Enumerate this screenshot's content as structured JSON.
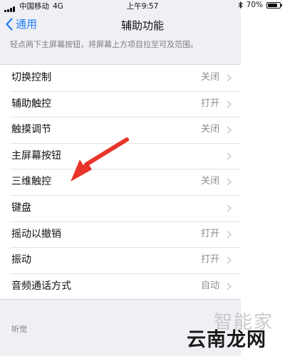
{
  "status_bar": {
    "carrier": "中国移动",
    "network": "4G",
    "time": "上午9:57",
    "battery": "70%"
  },
  "navbar": {
    "back_label": "通用",
    "title": "辅助功能"
  },
  "description": "轻点两下主屏幕按钮，将屏幕上方项目拉至可及范围。",
  "rows": [
    {
      "label": "切换控制",
      "value": "关闭"
    },
    {
      "label": "辅助触控",
      "value": "打开"
    },
    {
      "label": "触摸调节",
      "value": "关闭"
    },
    {
      "label": "主屏幕按钮",
      "value": ""
    },
    {
      "label": "三维触控",
      "value": "关闭"
    },
    {
      "label": "键盘",
      "value": ""
    },
    {
      "label": "摇动以撤销",
      "value": "打开"
    },
    {
      "label": "振动",
      "value": "打开"
    },
    {
      "label": "音频通话方式",
      "value": "自动"
    }
  ],
  "section_header": "听觉",
  "watermark": {
    "top": "智能家",
    "bottom": "云南龙网"
  },
  "colors": {
    "accent": "#1f7cf6",
    "arrow": "#e8342a",
    "background": "#efeff4"
  }
}
